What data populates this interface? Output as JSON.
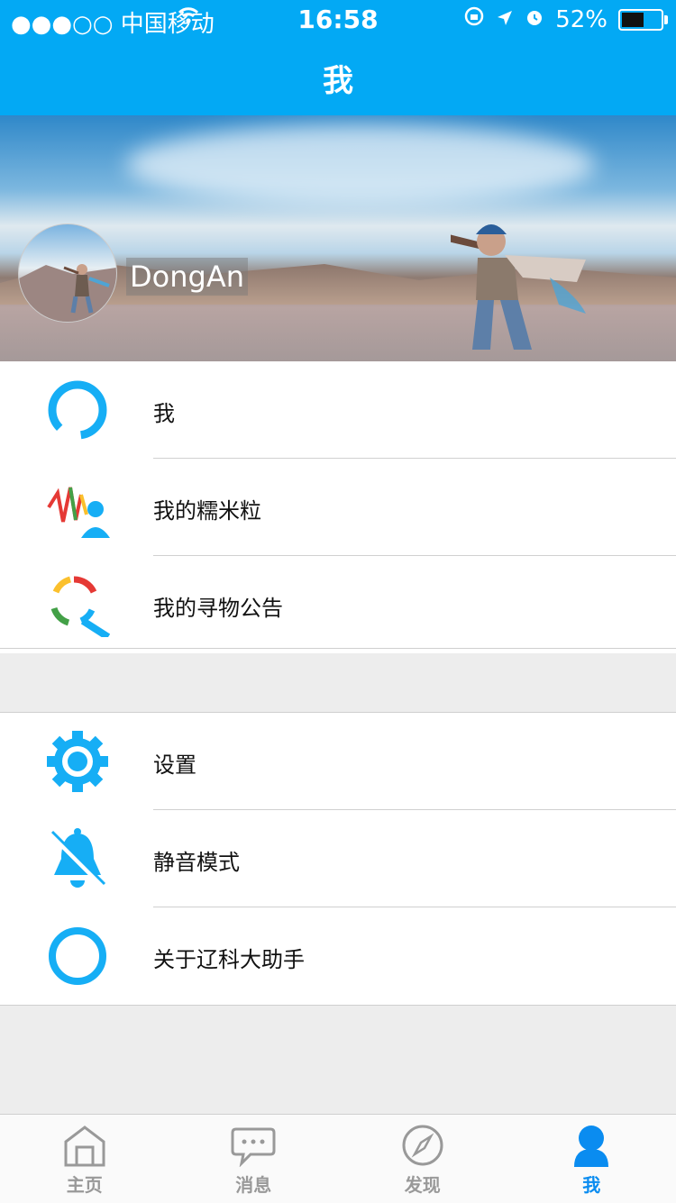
{
  "status_bar": {
    "carrier": "●●●○○ 中国移动",
    "time": "16:58",
    "battery": "52%",
    "battery_level": 0.52
  },
  "header": {
    "title": "我"
  },
  "profile": {
    "username": "DongAn"
  },
  "menu_group_1": [
    {
      "label": "我",
      "icon": "ring-icon"
    },
    {
      "label": "我的糯米粒",
      "icon": "wave-user-icon"
    },
    {
      "label": "我的寻物公告",
      "icon": "search-icon"
    }
  ],
  "menu_group_2": [
    {
      "label": "设置",
      "icon": "gear-icon"
    },
    {
      "label": "静音模式",
      "icon": "bell-off-icon"
    },
    {
      "label": "关于辽科大助手",
      "icon": "circle-icon"
    }
  ],
  "tabbar": [
    {
      "label": "主页",
      "icon": "home-icon",
      "active": false
    },
    {
      "label": "消息",
      "icon": "message-icon",
      "active": false
    },
    {
      "label": "发现",
      "icon": "compass-icon",
      "active": false
    },
    {
      "label": "我",
      "icon": "person-icon",
      "active": true
    }
  ],
  "colors": {
    "accent": "#03a9f4",
    "tab_active": "#0a8cf0",
    "tab_inactive": "#999999"
  }
}
